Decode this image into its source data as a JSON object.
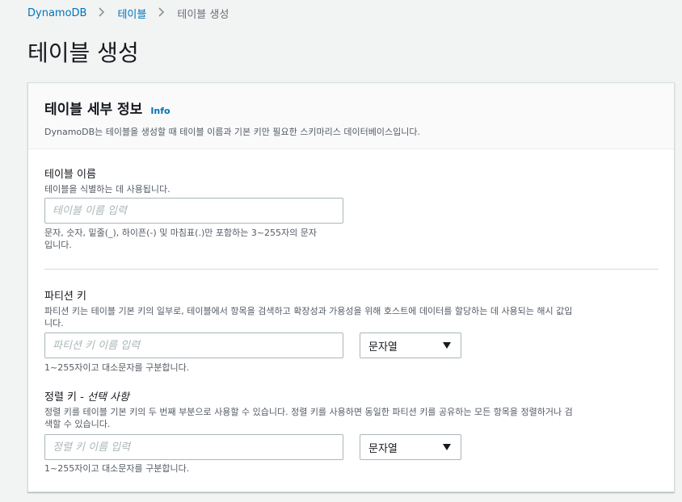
{
  "breadcrumb": {
    "items": [
      "DynamoDB",
      "테이블",
      "테이블 생성"
    ]
  },
  "page": {
    "title": "테이블 생성"
  },
  "panel": {
    "title": "테이블 세부 정보",
    "info_label": "Info",
    "description": "DynamoDB는 테이블을 생성할 때 테이블 이름과 기본 키만 필요한 스키마리스 데이터베이스입니다."
  },
  "table_name": {
    "label": "테이블 이름",
    "description": "테이블을 식별하는 데 사용됩니다.",
    "placeholder": "테이블 이름 입력",
    "value": "",
    "constraint_line1": "문자, 숫자, 밑줄(_), 하이픈(-) 및 마침표(.)만 포함하는 3~255자의 문자",
    "constraint_line2": "입니다."
  },
  "partition_key": {
    "label": "파티션 키",
    "description_line1": "파티션 키는 테이블 기본 키의 일부로, 테이블에서 항목을 검색하고 확장성과 가용성을 위해 호스트에 데이터를 할당하는 데 사용되는 해시 값입",
    "description_line2": "니다.",
    "placeholder": "파티션 키 이름 입력",
    "value": "",
    "type_selected": "문자열",
    "constraint": "1~255자이고 대소문자를 구분합니다."
  },
  "sort_key": {
    "label": "정렬 키 - ",
    "label_optional": "선택 사항",
    "description_line1": "정렬 키를 테이블 기본 키의 두 번째 부분으로 사용할 수 있습니다. 정렬 키를 사용하면 동일한 파티션 키를 공유하는 모든 항목을 정렬하거나 검",
    "description_line2": "색할 수 있습니다.",
    "placeholder": "정렬 키 이름 입력",
    "value": "",
    "type_selected": "문자열",
    "constraint": "1~255자이고 대소문자를 구분합니다."
  },
  "icons": {
    "breadcrumb_separator": "chevron-right-icon",
    "select_caret": "caret-down-icon"
  },
  "colors": {
    "link": "#0073bb",
    "background": "#f2f3f3",
    "panel_header": "#fafafa",
    "input_border": "#aab7b8"
  }
}
